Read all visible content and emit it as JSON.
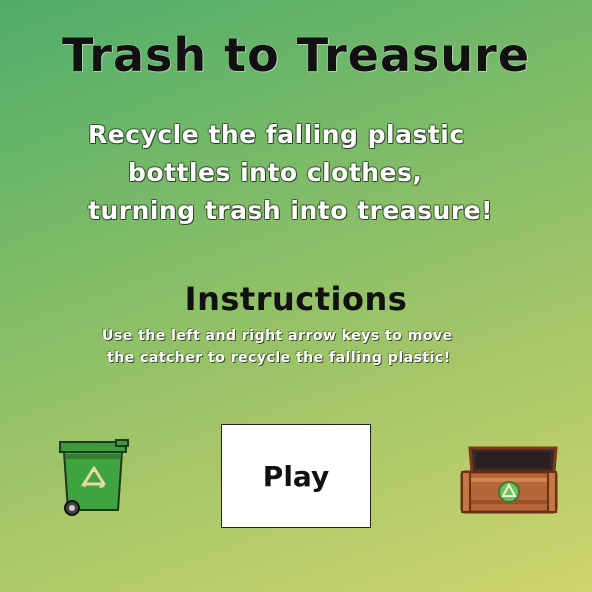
{
  "title": "Trash to Treasure",
  "tagline": {
    "line1": "Recycle the falling plastic",
    "line2": "bottles into clothes,",
    "line3": "turning trash into treasure!"
  },
  "instructions": {
    "heading": "Instructions",
    "line1": "Use the left and right arrow keys to move",
    "line2": "the catcher to recycle the falling plastic!"
  },
  "play_button": {
    "label": "Play"
  },
  "icons": {
    "left": "recycling-bin-icon",
    "right": "treasure-chest-icon"
  },
  "colors": {
    "background_top": "#4fad6a",
    "background_bottom": "#cfd46e",
    "bin_green": "#3d9a3d",
    "chest_brown": "#b5653a"
  }
}
